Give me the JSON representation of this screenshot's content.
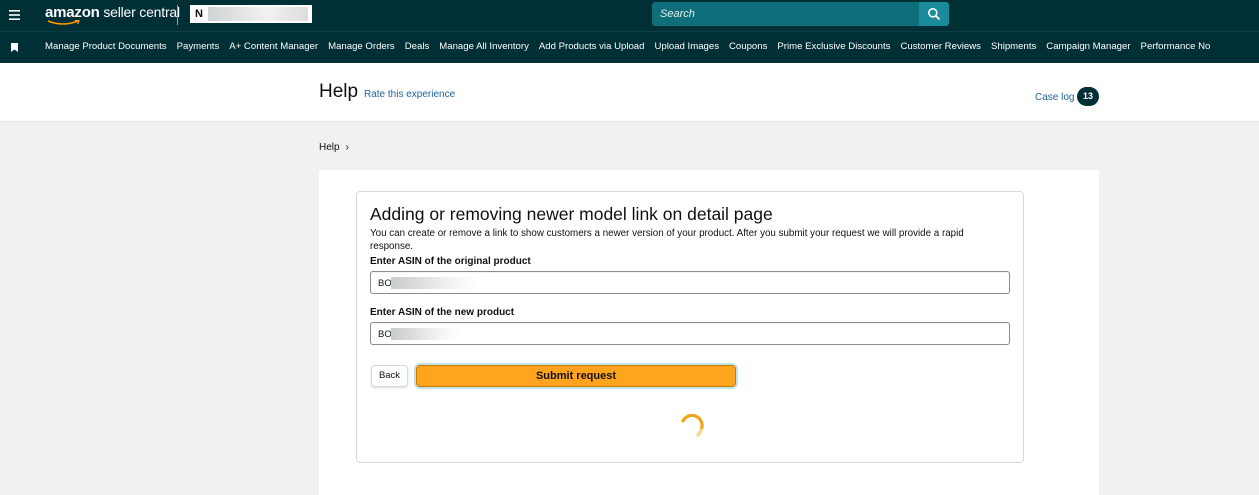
{
  "topbar": {
    "logo_brand": "amazon",
    "logo_product": " seller central",
    "account_prefix": "N",
    "search_placeholder": "Search"
  },
  "nav": {
    "items": [
      "Manage Product Documents",
      "Payments",
      "A+ Content Manager",
      "Manage Orders",
      "Deals",
      "Manage All Inventory",
      "Add Products via Upload",
      "Upload Images",
      "Coupons",
      "Prime Exclusive Discounts",
      "Customer Reviews",
      "Shipments",
      "Campaign Manager",
      "Performance No"
    ]
  },
  "help_header": {
    "title": "Help",
    "rate_link": "Rate this experience",
    "case_log": "Case log",
    "case_count": "13"
  },
  "breadcrumb": {
    "item": "Help",
    "separator": "›"
  },
  "form": {
    "title": "Adding or removing newer model link on detail page",
    "description": "You can create or remove a link to show customers a newer version of your product. After you submit your request we will provide a rapid response.",
    "original_label": "Enter ASIN of the original product",
    "original_value": "BO",
    "new_label": "Enter ASIN of the new product",
    "new_value": "BO",
    "back_label": "Back",
    "submit_label": "Submit request"
  },
  "colors": {
    "topbar": "#002f36",
    "search": "#0e6f7b",
    "link": "#2162a1",
    "submit": "#ffa41c",
    "spinner": "#f0a51f"
  }
}
